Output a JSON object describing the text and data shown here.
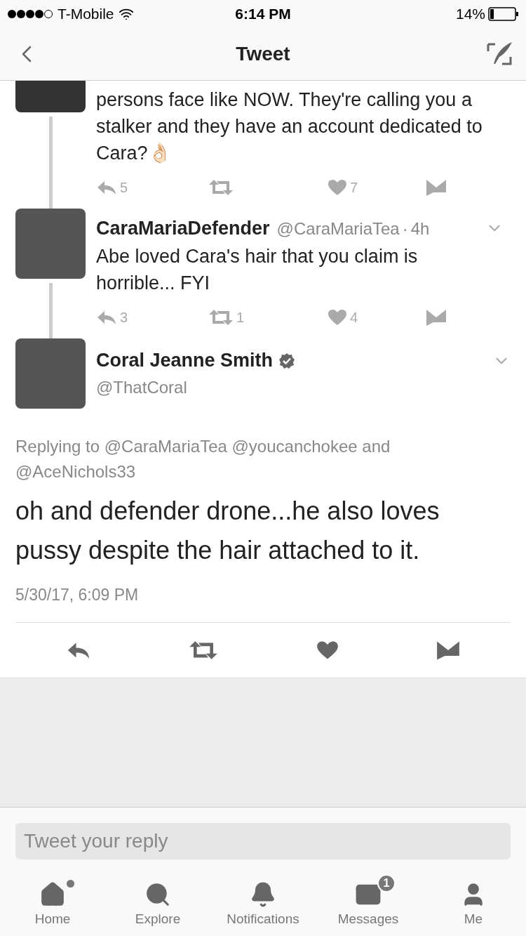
{
  "status_bar": {
    "carrier": "T-Mobile",
    "time": "6:14 PM",
    "battery": "14%"
  },
  "header": {
    "title": "Tweet"
  },
  "thread": [
    {
      "kind": "cut",
      "text": "persons face like NOW. They're calling you a stalker and they have an account dedicated to Cara?👌🏻",
      "replies": "5",
      "likes": "7"
    },
    {
      "kind": "full",
      "name": "CaraMariaDefender",
      "handle": "@CaraMariaTea",
      "separator": "·",
      "time": "4h",
      "text": "Abe loved Cara's hair that you claim is horrible... FYI",
      "replies": "3",
      "retweets": "1",
      "likes": "4"
    }
  ],
  "main_tweet": {
    "name": "Coral Jeanne Smith",
    "verified": true,
    "handle": "@ThatCoral",
    "replying_to": "Replying to @CaraMariaTea @youcanchokee and @AceNichols33",
    "text": "oh and defender drone...he also loves pussy despite the hair attached to it.",
    "timestamp": "5/30/17, 6:09 PM"
  },
  "reply_box": {
    "placeholder": "Tweet your reply"
  },
  "tab_bar": [
    {
      "label": "Home",
      "dot": true
    },
    {
      "label": "Explore",
      "dot": false
    },
    {
      "label": "Notifications",
      "dot": false
    },
    {
      "label": "Messages",
      "dot": false,
      "badge": "1"
    },
    {
      "label": "Me",
      "dot": false
    }
  ]
}
